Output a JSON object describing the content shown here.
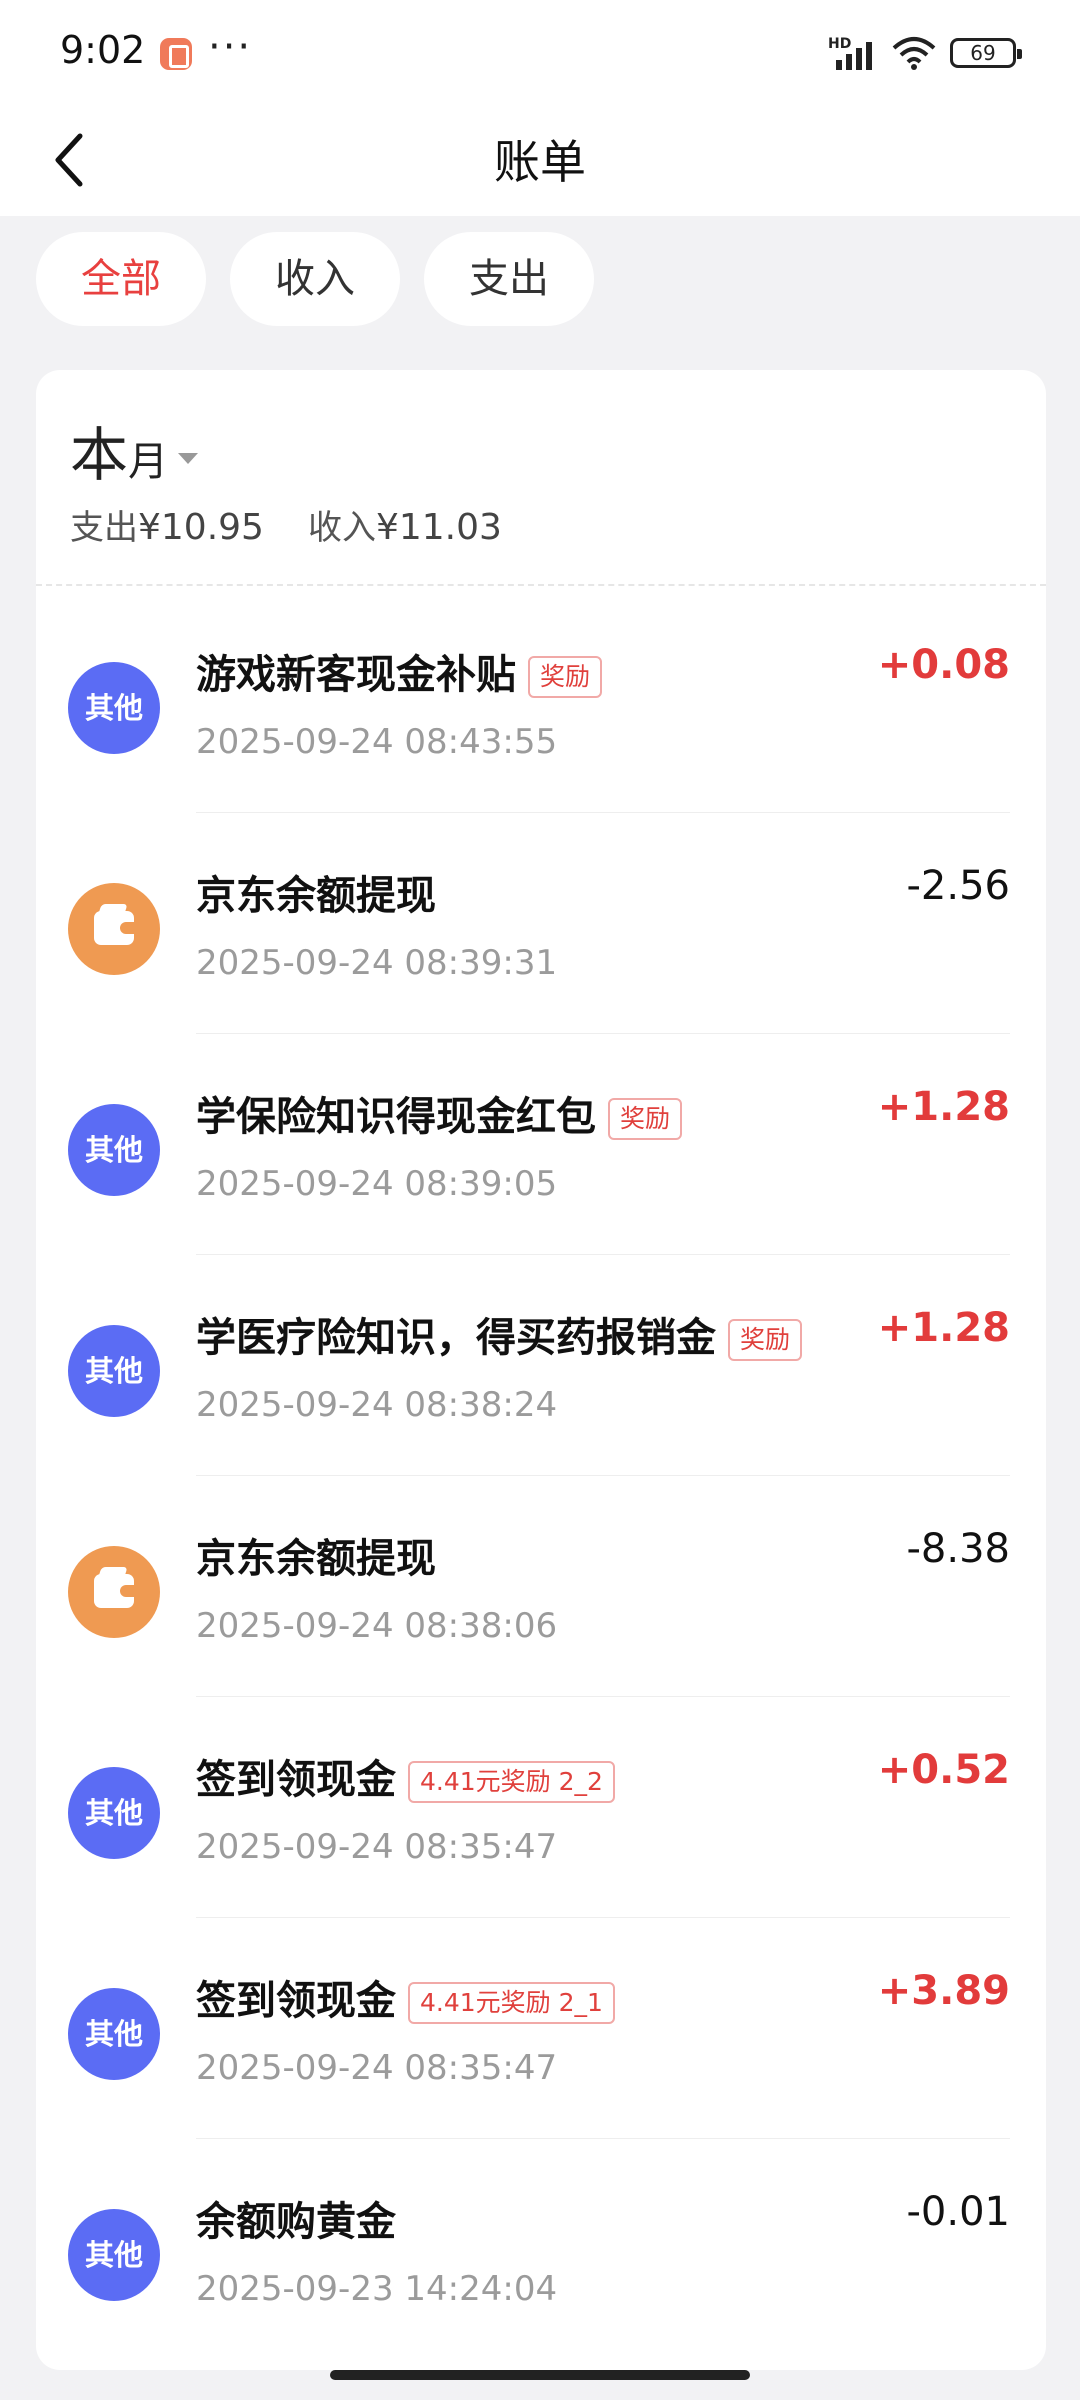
{
  "status_bar": {
    "time": "9:02",
    "dots": "···",
    "network": "HD",
    "battery": "69"
  },
  "header": {
    "title": "账单"
  },
  "tabs": [
    {
      "label": "全部",
      "active": true
    },
    {
      "label": "收入",
      "active": false
    },
    {
      "label": "支出",
      "active": false
    }
  ],
  "period": {
    "main": "本",
    "sub": "月"
  },
  "summary": {
    "expense_label": "支出",
    "expense_value": "¥10.95",
    "income_label": "收入",
    "income_value": "¥11.03"
  },
  "transactions": [
    {
      "avatar_text": "其他",
      "avatar_type": "other",
      "title": "游戏新客现金补贴",
      "badge": "奖励",
      "time": "2025-09-24 08:43:55",
      "amount": "+0.08",
      "direction": "income"
    },
    {
      "avatar_text": "",
      "avatar_type": "wallet",
      "title": "京东余额提现",
      "badge": "",
      "time": "2025-09-24 08:39:31",
      "amount": "-2.56",
      "direction": "expense"
    },
    {
      "avatar_text": "其他",
      "avatar_type": "other",
      "title": "学保险知识得现金红包",
      "badge": "奖励",
      "time": "2025-09-24 08:39:05",
      "amount": "+1.28",
      "direction": "income"
    },
    {
      "avatar_text": "其他",
      "avatar_type": "other",
      "title": "学医疗险知识，得买药报销金",
      "badge": "奖励",
      "time": "2025-09-24 08:38:24",
      "amount": "+1.28",
      "direction": "income"
    },
    {
      "avatar_text": "",
      "avatar_type": "wallet",
      "title": "京东余额提现",
      "badge": "",
      "time": "2025-09-24 08:38:06",
      "amount": "-8.38",
      "direction": "expense"
    },
    {
      "avatar_text": "其他",
      "avatar_type": "other",
      "title": "签到领现金",
      "badge": "4.41元奖励 2_2",
      "time": "2025-09-24 08:35:47",
      "amount": "+0.52",
      "direction": "income"
    },
    {
      "avatar_text": "其他",
      "avatar_type": "other",
      "title": "签到领现金",
      "badge": "4.41元奖励 2_1",
      "time": "2025-09-24 08:35:47",
      "amount": "+3.89",
      "direction": "income"
    },
    {
      "avatar_text": "其他",
      "avatar_type": "other",
      "title": "余额购黄金",
      "badge": "",
      "time": "2025-09-23 14:24:04",
      "amount": "-0.01",
      "direction": "expense"
    }
  ],
  "colors": {
    "accent_red": "#e23b3b",
    "avatar_other": "#5b6cf4",
    "avatar_wallet": "#ef9a52"
  }
}
